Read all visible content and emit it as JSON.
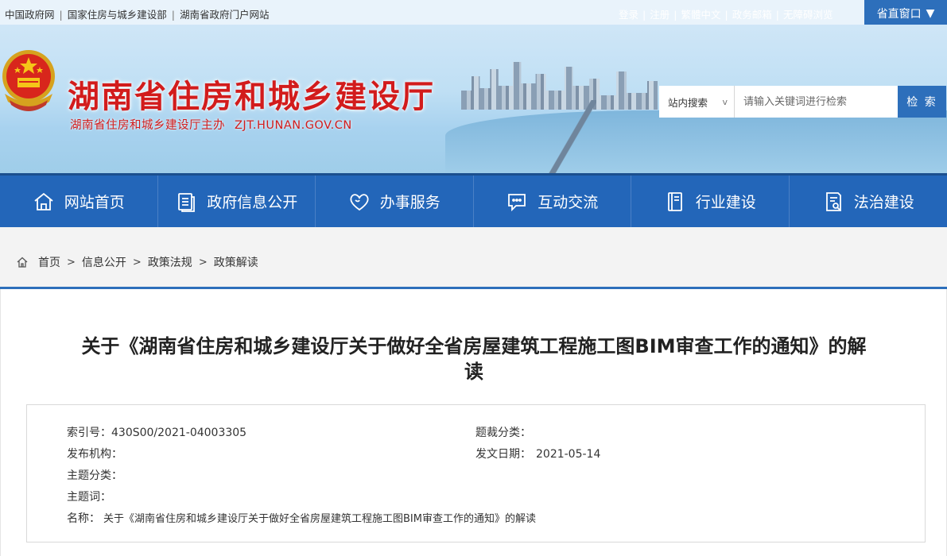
{
  "topbar": {
    "links": [
      "中国政府网",
      "国家住房与城乡建设部",
      "湖南省政府门户网站"
    ],
    "user_links": [
      "登录",
      "注册",
      "繁體中文",
      "政务邮箱",
      "无障碍浏览"
    ],
    "window_label": "省直窗口",
    "window_arrow": "▼"
  },
  "header": {
    "title": "湖南省住房和城乡建设厅",
    "subtitle": "湖南省住房和城乡建设厅主办",
    "domain": "ZJT.HUNAN.GOV.CN"
  },
  "search": {
    "scope": "站内搜索",
    "scope_chevron": "v",
    "placeholder": "请输入关键词进行检索",
    "button": "检 索"
  },
  "nav": {
    "items": [
      {
        "label": "网站首页",
        "icon": "home-icon"
      },
      {
        "label": "政府信息公开",
        "icon": "document-icon"
      },
      {
        "label": "办事服务",
        "icon": "heart-icon"
      },
      {
        "label": "互动交流",
        "icon": "chat-icon"
      },
      {
        "label": "行业建设",
        "icon": "book-icon"
      },
      {
        "label": "法治建设",
        "icon": "law-icon"
      }
    ]
  },
  "breadcrumb": {
    "items": [
      "首页",
      "信息公开",
      "政策法规",
      "政策解读"
    ],
    "separator": ">"
  },
  "document": {
    "title_line1": "关于《湖南省住房和城乡建设厅关于做好全省房屋建筑工程施工图BIM审查工作的通知》的解",
    "title_line2": "读",
    "meta": {
      "index_label": "索引号：",
      "index_value": "430S00/2021-04003305",
      "genre_label": "题裁分类：",
      "genre_value": "",
      "org_label": "发布机构：",
      "org_value": "",
      "date_label": "发文日期：",
      "date_value": "2021-05-14",
      "topic_label": "主题分类：",
      "topic_value": "",
      "keywords_label": "主题词：",
      "keywords_value": "",
      "name_label": "名称：",
      "name_value": "关于《湖南省住房和城乡建设厅关于做好全省房屋建筑工程施工图BIM审查工作的通知》的解读"
    }
  },
  "colors": {
    "primary_blue": "#2366b9",
    "title_red": "#d21c1c",
    "accent_line": "#2d6fbb"
  }
}
